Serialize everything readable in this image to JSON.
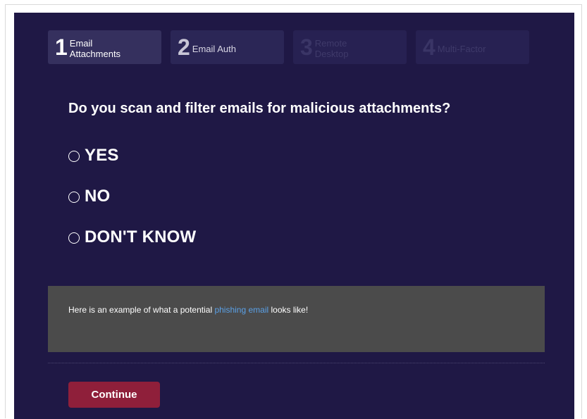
{
  "steps": [
    {
      "number": "1",
      "label": "Email Attachments",
      "state": "active"
    },
    {
      "number": "2",
      "label": "Email Auth",
      "state": "done"
    },
    {
      "number": "3",
      "label": "Remote Desktop",
      "state": "future"
    },
    {
      "number": "4",
      "label": "Multi-Factor",
      "state": "future"
    }
  ],
  "question": "Do you scan and filter emails for malicious attachments?",
  "options": [
    {
      "label": "YES"
    },
    {
      "label": "NO"
    },
    {
      "label": "DON'T KNOW"
    }
  ],
  "example": {
    "prefix": "Here is an example of what a potential ",
    "link_text": "phishing email",
    "suffix": " looks like!"
  },
  "continue_label": "Continue",
  "colors": {
    "panel_bg": "#1f1845",
    "example_bg": "#4b4b4b",
    "link": "#5aa0e6",
    "button": "#8f1f3a"
  }
}
